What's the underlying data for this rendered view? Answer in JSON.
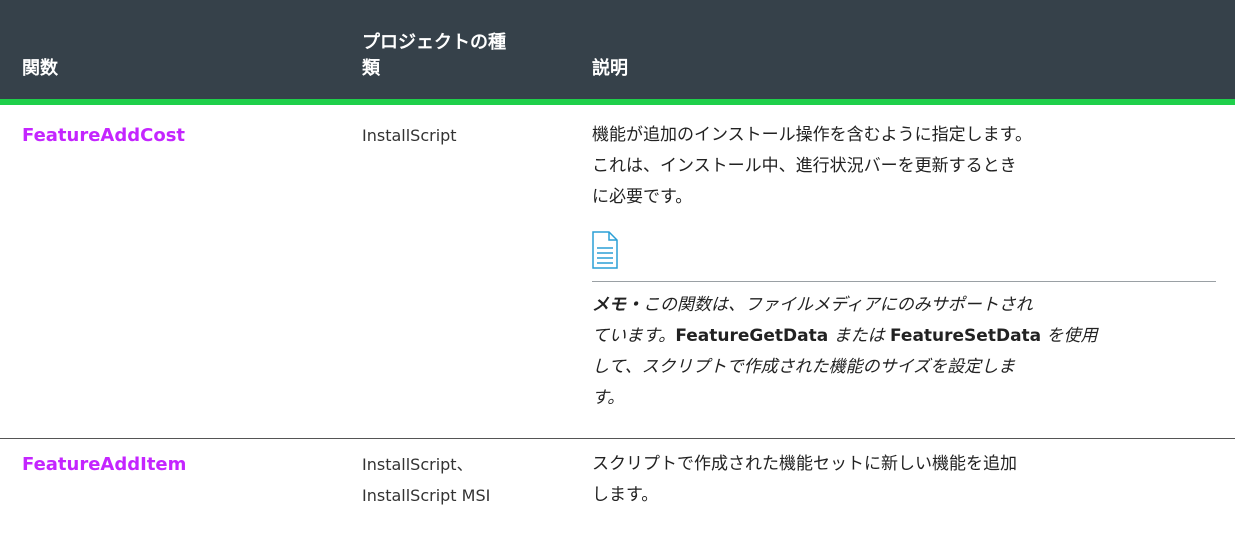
{
  "header": {
    "col_function": "関数",
    "col_project_line1": "プロジェクトの種",
    "col_project_line2": "類",
    "col_description": "説明"
  },
  "rows": [
    {
      "function": "FeatureAddCost",
      "project_line1": "InstallScript",
      "desc_line1": "機能が追加のインストール操作を含むように指定します。",
      "desc_line2": "これは、インストール中、進行状況バーを更新するとき",
      "desc_line3": "に必要です。",
      "note": {
        "icon": "note-icon",
        "label": "メモ・",
        "line1_text": "この関数は、ファイルメディアにのみサポートされ",
        "line2_pre": "ています。",
        "line2_fn1": "FeatureGetData",
        "line2_mid": " または ",
        "line2_fn2": "FeatureSetData",
        "line2_post": " を使用",
        "line3": "して、スクリプトで作成された機能のサイズを設定しま",
        "line4": "す。"
      }
    },
    {
      "function": "FeatureAddItem",
      "project_line1": "InstallScript、",
      "project_line2": "InstallScript MSI",
      "desc_line1": "スクリプトで作成された機能セットに新しい機能を追加",
      "desc_line2": "します。"
    }
  ],
  "colors": {
    "header_bg": "#36414a",
    "header_rule": "#1fcf4a",
    "link": "#c425ff"
  }
}
